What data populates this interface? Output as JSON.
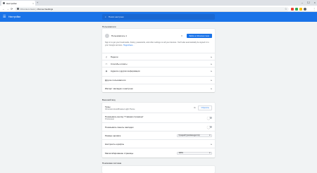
{
  "tab": {
    "title": "Настройки",
    "close": "×",
    "new_tab": "+"
  },
  "window_controls": {
    "minimize": "–",
    "maximize": "☐",
    "close": "×"
  },
  "toolbar": {
    "back": "←",
    "forward": "→",
    "reload": "⟳",
    "url_site": "Chromium Gost",
    "url_sep": "|",
    "url_path": "chrome://settings",
    "star": "☆",
    "menu": "⋮",
    "extension_colors": [
      "#ea4335",
      "#34a853",
      "#fbbc04",
      "#5f6368"
    ]
  },
  "header": {
    "menu_icon": "☰",
    "title": "Настройки",
    "search_icon": "⌕",
    "search_placeholder": "Поиск настроек"
  },
  "people": {
    "section_title": "Пользователи",
    "person_name": "Пользователь 1",
    "sync_button": "Войти в Chromium Gost",
    "description": "Sign in to get your bookmarks, history, passwords, and other settings on all your devices. You'll also automatically be signed in to your Google services.",
    "learn_more": "Подробнее...",
    "items": [
      {
        "label": "Пароли",
        "icon": "key-icon",
        "glyph": "⚷"
      },
      {
        "label": "Способы оплаты",
        "icon": "card-icon",
        "glyph": "▭"
      },
      {
        "label": "Адреса и другая информация",
        "icon": "pin-icon",
        "glyph": "◉"
      }
    ],
    "other_users": "Другие пользователи",
    "import": "Импорт закладок и настроек"
  },
  "appearance": {
    "section_title": "Внешний вид",
    "themes_label": "Темы",
    "themes_sub": "Chromium-Gost-Browser-Light-Theme",
    "reset_button": "Сбросить",
    "home_button_label": "Показывать кнопку \"Главная страница\"",
    "home_button_sub": "Отключено",
    "bookmarks_bar_label": "Показывать панель закладок",
    "font_size_label": "Размер шрифта",
    "font_size_value": "Средний (рекомендуется)",
    "customize_fonts_label": "Настроить шрифты",
    "zoom_label": "Масштабирование страницы",
    "zoom_value": "100%"
  },
  "search_engine": {
    "section_title": "Поисковая система"
  }
}
